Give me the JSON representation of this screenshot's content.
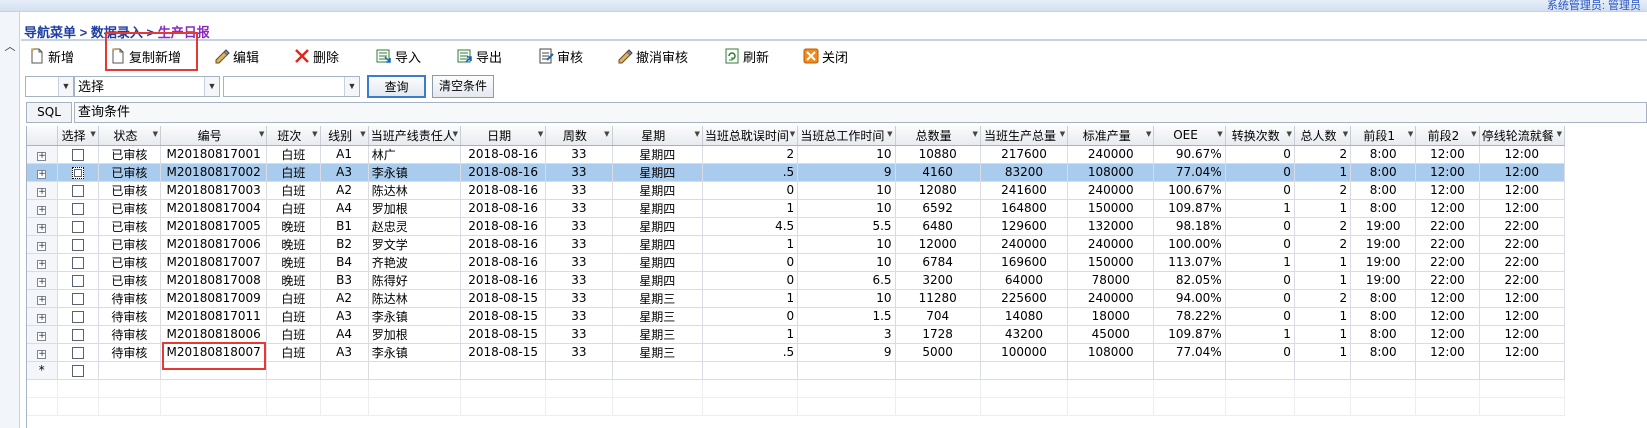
{
  "header": {
    "user_info": "系统管理员: 管理员"
  },
  "breadcrumb": {
    "root": "导航菜单",
    "sep1": " > ",
    "section": "数据录入",
    "sep2": " > ",
    "current": "生产日报"
  },
  "toolbar": {
    "new": "新增",
    "copy_new": "复制新增",
    "edit": "编辑",
    "delete": "删除",
    "import": "导入",
    "export": "导出",
    "audit": "审核",
    "unaudit": "撤消审核",
    "refresh": "刷新",
    "close": "关闭"
  },
  "filter": {
    "combo1_value": "",
    "combo2_value": "选择",
    "combo3_value": "",
    "query": "查询",
    "clear": "清空条件"
  },
  "sql": {
    "label": "SQL",
    "condition": "查询条件"
  },
  "grid": {
    "columns": [
      "选择",
      "状态",
      "编号",
      "班次",
      "线别",
      "当班产线责任人",
      "日期",
      "周数",
      "星期",
      "当班总耽误时间",
      "当班总工作时间",
      "总数量",
      "当班生产总量",
      "标准产量",
      "OEE",
      "转换次数",
      "总人数",
      "前段1",
      "前段2",
      "停线轮流就餐"
    ],
    "new_row_marker": "*",
    "rows": [
      {
        "status": "已审核",
        "code": "M20180817001",
        "shift": "白班",
        "line": "A1",
        "owner": "林广",
        "date": "2018-08-16",
        "week": "33",
        "weekday": "星期四",
        "delay": "2",
        "worktime": "10",
        "total": "10880",
        "shift_total": "217600",
        "std": "240000",
        "oee": "90.67%",
        "switch": "0",
        "people": "2",
        "f1": "8:00",
        "f2": "12:00",
        "meal": "12:00"
      },
      {
        "status": "已审核",
        "code": "M20180817002",
        "shift": "白班",
        "line": "A3",
        "owner": "李永镇",
        "date": "2018-08-16",
        "week": "33",
        "weekday": "星期四",
        "delay": ".5",
        "worktime": "9",
        "total": "4160",
        "shift_total": "83200",
        "std": "108000",
        "oee": "77.04%",
        "switch": "0",
        "people": "1",
        "f1": "8:00",
        "f2": "12:00",
        "meal": "12:00"
      },
      {
        "status": "已审核",
        "code": "M20180817003",
        "shift": "白班",
        "line": "A2",
        "owner": "陈达林",
        "date": "2018-08-16",
        "week": "33",
        "weekday": "星期四",
        "delay": "0",
        "worktime": "10",
        "total": "12080",
        "shift_total": "241600",
        "std": "240000",
        "oee": "100.67%",
        "switch": "0",
        "people": "2",
        "f1": "8:00",
        "f2": "12:00",
        "meal": "12:00"
      },
      {
        "status": "已审核",
        "code": "M20180817004",
        "shift": "白班",
        "line": "A4",
        "owner": "罗加根",
        "date": "2018-08-16",
        "week": "33",
        "weekday": "星期四",
        "delay": "1",
        "worktime": "10",
        "total": "6592",
        "shift_total": "164800",
        "std": "150000",
        "oee": "109.87%",
        "switch": "1",
        "people": "1",
        "f1": "8:00",
        "f2": "12:00",
        "meal": "12:00"
      },
      {
        "status": "已审核",
        "code": "M20180817005",
        "shift": "晚班",
        "line": "B1",
        "owner": "赵忠灵",
        "date": "2018-08-16",
        "week": "33",
        "weekday": "星期四",
        "delay": "4.5",
        "worktime": "5.5",
        "total": "6480",
        "shift_total": "129600",
        "std": "132000",
        "oee": "98.18%",
        "switch": "0",
        "people": "2",
        "f1": "19:00",
        "f2": "22:00",
        "meal": "22:00"
      },
      {
        "status": "已审核",
        "code": "M20180817006",
        "shift": "晚班",
        "line": "B2",
        "owner": "罗文学",
        "date": "2018-08-16",
        "week": "33",
        "weekday": "星期四",
        "delay": "1",
        "worktime": "10",
        "total": "12000",
        "shift_total": "240000",
        "std": "240000",
        "oee": "100.00%",
        "switch": "0",
        "people": "2",
        "f1": "19:00",
        "f2": "22:00",
        "meal": "22:00"
      },
      {
        "status": "已审核",
        "code": "M20180817007",
        "shift": "晚班",
        "line": "B4",
        "owner": "齐艳波",
        "date": "2018-08-16",
        "week": "33",
        "weekday": "星期四",
        "delay": "0",
        "worktime": "10",
        "total": "6784",
        "shift_total": "169600",
        "std": "150000",
        "oee": "113.07%",
        "switch": "1",
        "people": "1",
        "f1": "19:00",
        "f2": "22:00",
        "meal": "22:00"
      },
      {
        "status": "已审核",
        "code": "M20180817008",
        "shift": "晚班",
        "line": "B3",
        "owner": "陈得好",
        "date": "2018-08-16",
        "week": "33",
        "weekday": "星期四",
        "delay": "0",
        "worktime": "6.5",
        "total": "3200",
        "shift_total": "64000",
        "std": "78000",
        "oee": "82.05%",
        "switch": "0",
        "people": "1",
        "f1": "19:00",
        "f2": "22:00",
        "meal": "22:00"
      },
      {
        "status": "待审核",
        "code": "M20180817009",
        "shift": "白班",
        "line": "A2",
        "owner": "陈达林",
        "date": "2018-08-15",
        "week": "33",
        "weekday": "星期三",
        "delay": "1",
        "worktime": "10",
        "total": "11280",
        "shift_total": "225600",
        "std": "240000",
        "oee": "94.00%",
        "switch": "0",
        "people": "2",
        "f1": "8:00",
        "f2": "12:00",
        "meal": "12:00"
      },
      {
        "status": "待审核",
        "code": "M20180817011",
        "shift": "白班",
        "line": "A3",
        "owner": "李永镇",
        "date": "2018-08-15",
        "week": "33",
        "weekday": "星期三",
        "delay": "0",
        "worktime": "1.5",
        "total": "704",
        "shift_total": "14080",
        "std": "18000",
        "oee": "78.22%",
        "switch": "0",
        "people": "1",
        "f1": "8:00",
        "f2": "12:00",
        "meal": "12:00"
      },
      {
        "status": "待审核",
        "code": "M20180818006",
        "shift": "白班",
        "line": "A4",
        "owner": "罗加根",
        "date": "2018-08-15",
        "week": "33",
        "weekday": "星期三",
        "delay": "1",
        "worktime": "3",
        "total": "1728",
        "shift_total": "43200",
        "std": "45000",
        "oee": "109.87%",
        "switch": "1",
        "people": "1",
        "f1": "8:00",
        "f2": "12:00",
        "meal": "12:00"
      },
      {
        "status": "待审核",
        "code": "M20180818007",
        "shift": "白班",
        "line": "A3",
        "owner": "李永镇",
        "date": "2018-08-15",
        "week": "33",
        "weekday": "星期三",
        "delay": ".5",
        "worktime": "9",
        "total": "5000",
        "shift_total": "100000",
        "std": "108000",
        "oee": "77.04%",
        "switch": "0",
        "people": "1",
        "f1": "8:00",
        "f2": "12:00",
        "meal": "12:00"
      }
    ]
  },
  "colors": {
    "highlight": "#e53935",
    "selected_row": "#a9cbee",
    "breadcrumb": "#2040a0"
  }
}
